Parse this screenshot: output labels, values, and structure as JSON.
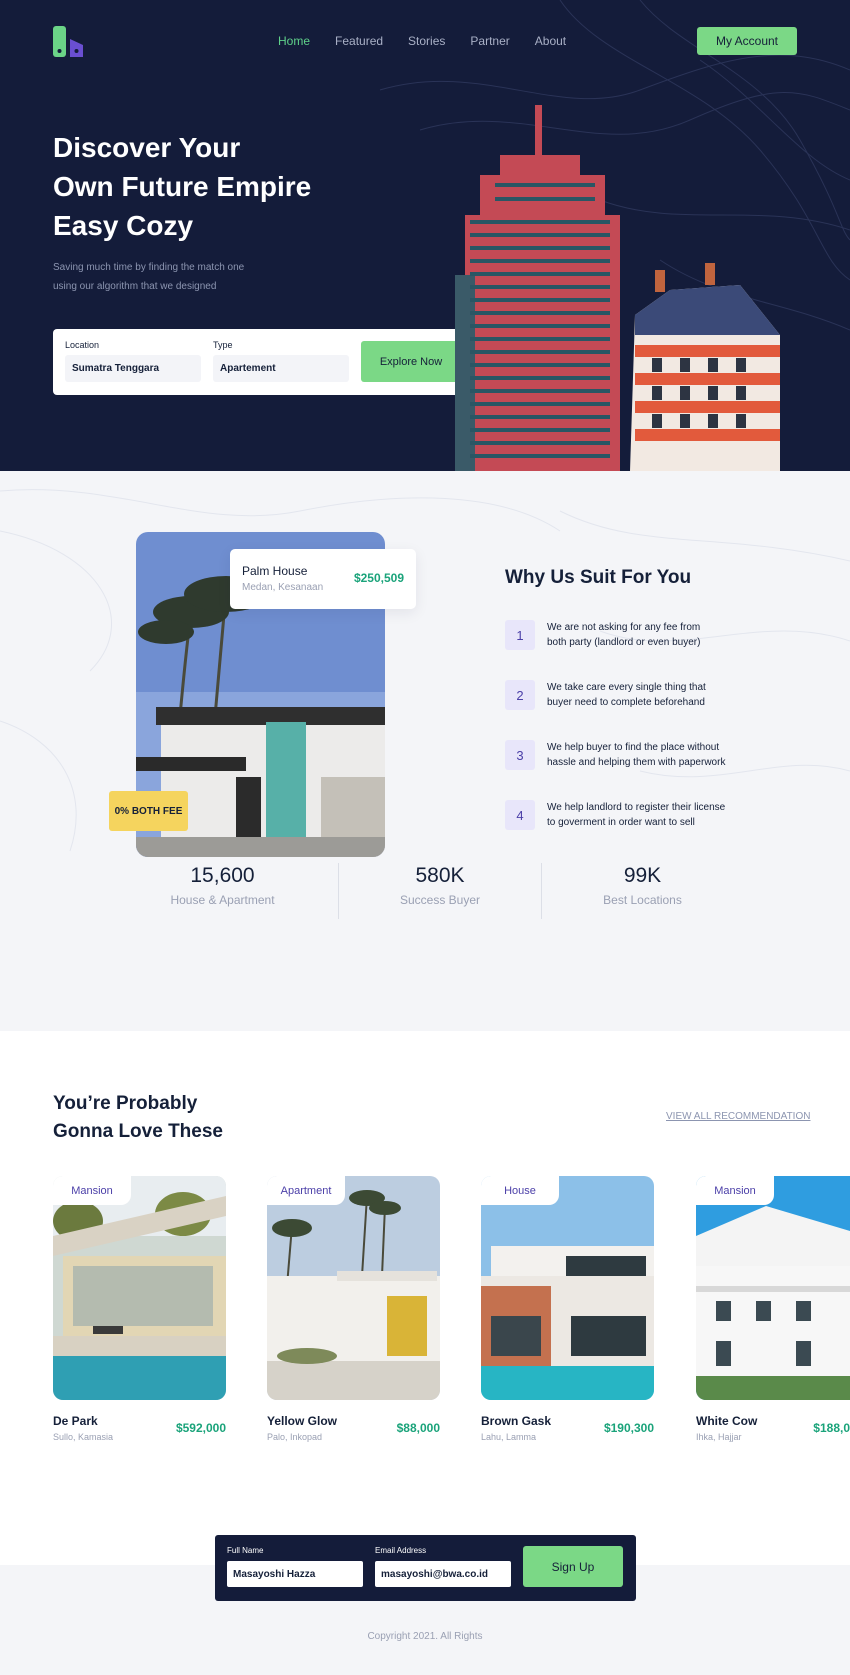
{
  "nav": {
    "items": [
      {
        "label": "Home",
        "active": true
      },
      {
        "label": "Featured",
        "active": false
      },
      {
        "label": "Stories",
        "active": false
      },
      {
        "label": "Partner",
        "active": false
      },
      {
        "label": "About",
        "active": false
      }
    ],
    "account_label": "My Account"
  },
  "hero": {
    "title_line1": "Discover Your",
    "title_line2": "Own Future Empire",
    "title_line3": "Easy Cozy",
    "subtitle_line1": "Saving much time by finding the match one",
    "subtitle_line2": "using our algorithm that we designed",
    "search": {
      "location_label": "Location",
      "location_value": "Sumatra Tenggara",
      "type_label": "Type",
      "type_value": "Apartement",
      "button_label": "Explore Now"
    }
  },
  "featured": {
    "name": "Palm House",
    "location": "Medan, Kesanaan",
    "price": "$250,509",
    "badge": "0% BOTH FEE"
  },
  "why": {
    "title": "Why Us Suit For You",
    "steps": [
      {
        "num": "1",
        "line1": "We are not asking for any fee from",
        "line2": "both party (landlord or even buyer)"
      },
      {
        "num": "2",
        "line1": "We take care every single thing that",
        "line2": "buyer need to complete beforehand"
      },
      {
        "num": "3",
        "line1": "We help buyer to find the place without",
        "line2": "hassle and helping them with paperwork"
      },
      {
        "num": "4",
        "line1": "We help landlord to register their license",
        "line2": "to goverment in order want to sell"
      }
    ]
  },
  "stats": [
    {
      "value": "15,600",
      "label": "House & Apartment"
    },
    {
      "value": "580K",
      "label": "Success Buyer"
    },
    {
      "value": "99K",
      "label": "Best Locations"
    }
  ],
  "recommendation": {
    "title_line1": "You’re Probably",
    "title_line2": "Gonna Love These",
    "view_all": "VIEW ALL RECOMMENDATION",
    "cards": [
      {
        "tag": "Mansion",
        "name": "De Park",
        "location": "Sullo, Kamasia",
        "price": "$592,000"
      },
      {
        "tag": "Apartment",
        "name": "Yellow Glow",
        "location": "Palo, Inkopad",
        "price": "$88,000"
      },
      {
        "tag": "House",
        "name": "Brown Gask",
        "location": "Lahu, Lamma",
        "price": "$190,300"
      },
      {
        "tag": "Mansion",
        "name": "White Cow",
        "location": "Ihka, Hajjar",
        "price": "$188,0"
      }
    ]
  },
  "signup": {
    "name_label": "Full Name",
    "name_value": "Masayoshi Hazza",
    "email_label": "Email Address",
    "email_value": "masayoshi@bwa.co.id",
    "button_label": "Sign Up"
  },
  "footer": {
    "copyright": "Copyright 2021. All Rights"
  },
  "colors": {
    "navy": "#141c3a",
    "green": "#7bd886",
    "price_green": "#1aa37a",
    "purple": "#4b3fa8",
    "yellow": "#f5d45e"
  }
}
